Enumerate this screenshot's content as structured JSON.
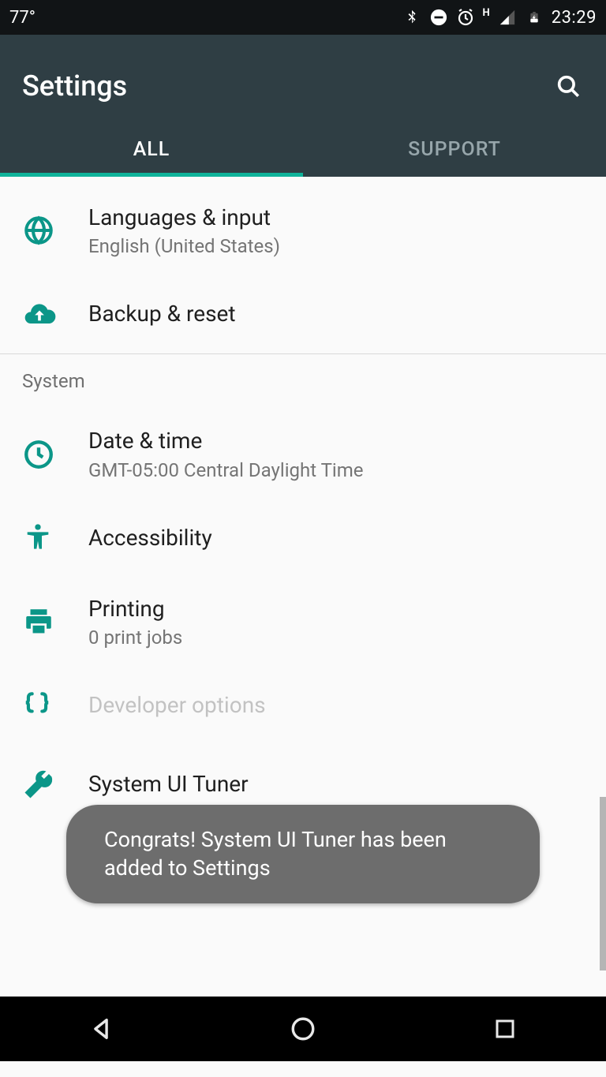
{
  "status": {
    "temperature": "77°",
    "time": "23:29",
    "network_indicator": "H"
  },
  "header": {
    "title": "Settings"
  },
  "tabs": {
    "all": "ALL",
    "support": "SUPPORT",
    "active": "all"
  },
  "items": {
    "languages": {
      "title": "Languages & input",
      "subtitle": "English (United States)"
    },
    "backup": {
      "title": "Backup & reset"
    },
    "datetime": {
      "title": "Date & time",
      "subtitle": "GMT-05:00 Central Daylight Time"
    },
    "accessibility": {
      "title": "Accessibility"
    },
    "printing": {
      "title": "Printing",
      "subtitle": "0 print jobs"
    },
    "developer": {
      "title": "Developer options"
    },
    "uituner": {
      "title": "System UI Tuner"
    }
  },
  "sections": {
    "system": "System"
  },
  "toast": {
    "message": "Congrats! System UI Tuner has been added to Settings"
  }
}
